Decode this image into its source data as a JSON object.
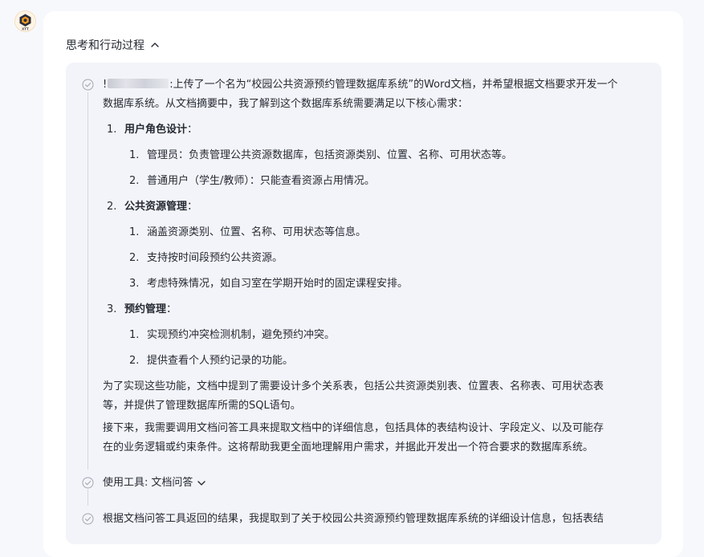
{
  "avatar": {
    "label": "XTT"
  },
  "thinking": {
    "header_label": "思考和行动过程"
  },
  "step1": {
    "line1_prefix": "!",
    "line1_suffix": ":上传了一个名为“校园公共资源预约管理数据库系统”的Word文档，并希望根据文档要求开发一个",
    "line2": "数据库系统。从文档摘要中，我了解到这个数据库系统需要满足以下核心需求：",
    "sections": [
      {
        "num": "1.",
        "title": "用户角色设计",
        "colon": "：",
        "items": [
          {
            "num": "1.",
            "text": "管理员：负责管理公共资源数据库，包括资源类别、位置、名称、可用状态等。"
          },
          {
            "num": "2.",
            "text": "普通用户（学生/教师）：只能查看资源占用情况。"
          }
        ]
      },
      {
        "num": "2.",
        "title": "公共资源管理",
        "colon": "：",
        "items": [
          {
            "num": "1.",
            "text": "涵盖资源类别、位置、名称、可用状态等信息。"
          },
          {
            "num": "2.",
            "text": "支持按时间段预约公共资源。"
          },
          {
            "num": "3.",
            "text": "考虑特殊情况，如自习室在学期开始时的固定课程安排。"
          }
        ]
      },
      {
        "num": "3.",
        "title": "预约管理",
        "colon": "：",
        "items": [
          {
            "num": "1.",
            "text": "实现预约冲突检测机制，避免预约冲突。"
          },
          {
            "num": "2.",
            "text": "提供查看个人预约记录的功能。"
          }
        ]
      }
    ],
    "para1_line1": "为了实现这些功能，文档中提到了需要设计多个关系表，包括公共资源类别表、位置表、名称表、可用状态表",
    "para1_line2": "等，并提供了管理数据库所需的SQL语句。",
    "para2_line1": "接下来，我需要调用文档问答工具来提取文档中的详细信息，包括具体的表结构设计、字段定义、以及可能存",
    "para2_line2": "在的业务逻辑或约束条件。这将帮助我更全面地理解用户需求，并据此开发出一个符合要求的数据库系统。"
  },
  "tool_step": {
    "label": "使用工具:",
    "value": "文档问答"
  },
  "step3": {
    "line1": "根据文档问答工具返回的结果，我提取到了关于校园公共资源预约管理数据库系统的详细设计信息，包括表结"
  },
  "icons": {
    "step_done": "check-circle-icon",
    "collapse": "chevron-up-icon",
    "expand": "chevron-down-icon"
  },
  "colors": {
    "page_bg": "#f7f8fc",
    "panel_bg": "#f3f4f9",
    "text": "#262a33",
    "icon": "#a3a7b3"
  }
}
